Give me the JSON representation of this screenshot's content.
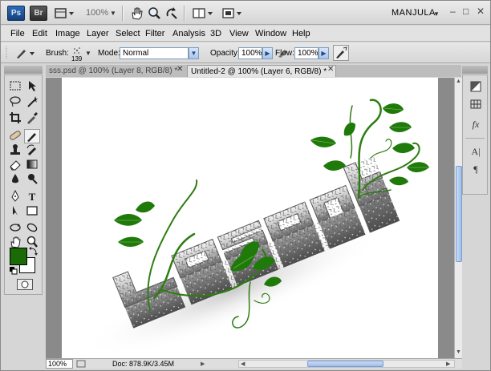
{
  "appbar": {
    "ps_logo": "Ps",
    "br_logo": "Br",
    "zoom": "100%",
    "workspace": "MANJULA",
    "icons": [
      "screen-mode-icon",
      "hand-icon",
      "zoom-icon",
      "rotate-view-icon",
      "arrange-documents-icon",
      "screen-mode-icon"
    ]
  },
  "menu": {
    "items": [
      "File",
      "Edit",
      "Image",
      "Layer",
      "Select",
      "Filter",
      "Analysis",
      "3D",
      "View",
      "Window",
      "Help"
    ]
  },
  "options": {
    "brush_label": "Brush:",
    "brush_size": "139",
    "mode_label": "Mode:",
    "mode_value": "Normal",
    "opacity_label": "Opacity:",
    "opacity_value": "100%",
    "flow_label": "Flow:",
    "flow_value": "100%"
  },
  "tabs": [
    {
      "label": "sss.psd @ 100% (Layer 8, RGB/8) *",
      "active": false
    },
    {
      "label": "Untitled-2 @ 100% (Layer 6, RGB/8) *",
      "active": true
    }
  ],
  "colors": {
    "foreground": "#1a6b06",
    "background": "#ffffff",
    "vine": "#2e7d12",
    "leaf": "#1f7a0a"
  },
  "status": {
    "zoom": "100%",
    "doc": "Doc: 878.9K/3.45M"
  }
}
